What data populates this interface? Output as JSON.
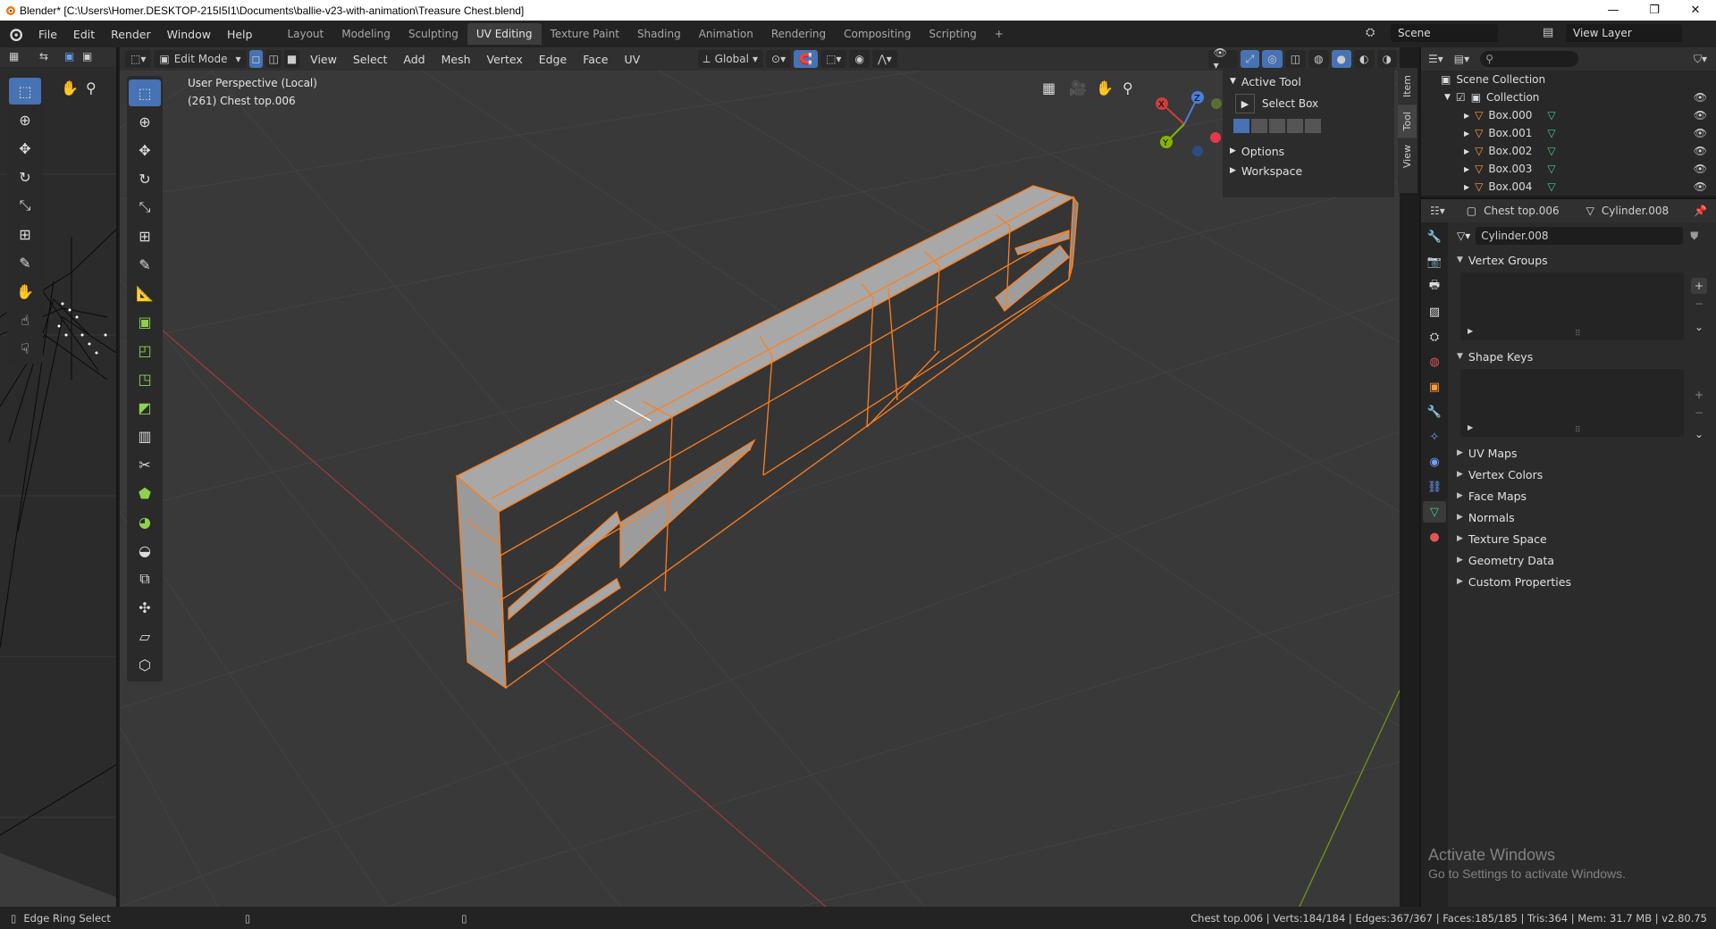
{
  "window": {
    "title": "Blender* [C:\\Users\\Homer.DESKTOP-215I5I1\\Documents\\ballie-v23-with-animation\\Treasure Chest.blend]",
    "minimize": "—",
    "restore": "❐",
    "close": "✕"
  },
  "menubar": {
    "items": [
      "File",
      "Edit",
      "Render",
      "Window",
      "Help"
    ],
    "workspaces": [
      "Layout",
      "Modeling",
      "Sculpting",
      "UV Editing",
      "Texture Paint",
      "Shading",
      "Animation",
      "Rendering",
      "Compositing",
      "Scripting"
    ],
    "add_workspace": "+",
    "scene_label": "Scene",
    "view_layer_label": "View Layer"
  },
  "viewport": {
    "mode": "Edit Mode",
    "menus": [
      "View",
      "Select",
      "Add",
      "Mesh",
      "Vertex",
      "Edge",
      "Face",
      "UV"
    ],
    "orientation": "Global",
    "perspective_label": "User Perspective (Local)",
    "object_label": "(261) Chest top.006",
    "gizmo": {
      "x": "X",
      "y": "Y",
      "z": "Z"
    }
  },
  "npanel": {
    "active_tool_header": "Active Tool",
    "tool_name": "Select Box",
    "options_header": "Options",
    "workspace_header": "Workspace",
    "tabs": [
      "Item",
      "Tool",
      "View"
    ]
  },
  "outliner": {
    "root": "Scene Collection",
    "collection": "Collection",
    "objects": [
      "Box.000",
      "Box.001",
      "Box.002",
      "Box.003",
      "Box.004"
    ]
  },
  "properties": {
    "object_name": "Chest top.006",
    "mesh_name": "Cylinder.008",
    "data_field": "Cylinder.008",
    "panels_open": [
      "Vertex Groups",
      "Shape Keys"
    ],
    "panels_closed": [
      "UV Maps",
      "Vertex Colors",
      "Face Maps",
      "Normals",
      "Texture Space",
      "Geometry Data",
      "Custom Properties"
    ]
  },
  "statusbar": {
    "left": "Edge Ring Select",
    "right": "Chest top.006 | Verts:184/184 | Edges:367/367 | Faces:185/185 | Tris:364 | Mem: 31.7 MB | v2.80.75"
  },
  "watermark": {
    "line1": "Activate Windows",
    "line2": "Go to Settings to activate Windows."
  },
  "colors": {
    "accent": "#4772b3",
    "selection": "#ff7f1e",
    "x_axis": "#cc3d3d",
    "y_axis": "#85b300"
  }
}
